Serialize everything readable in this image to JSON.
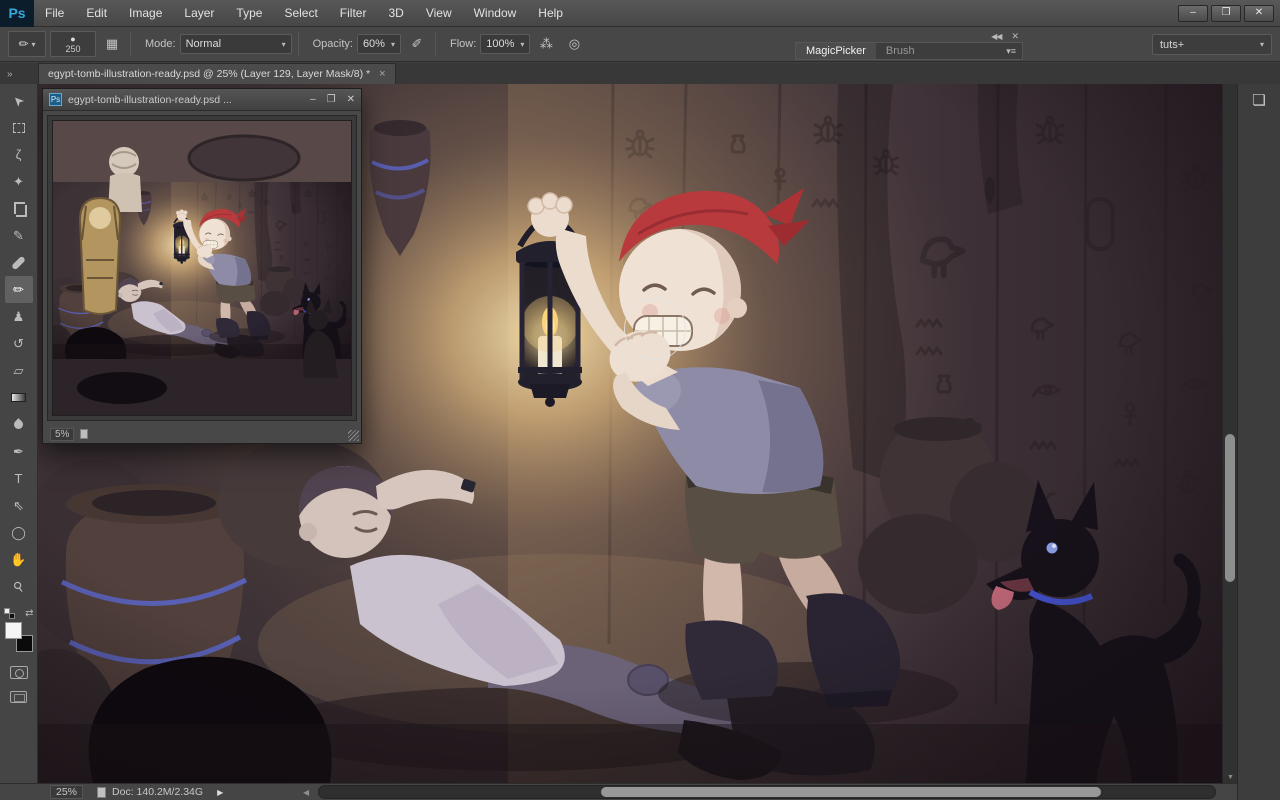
{
  "window_controls": {
    "minimize": "–",
    "restore": "❐",
    "close": "✕"
  },
  "menu_bar": {
    "logo": "Ps",
    "items": [
      "File",
      "Edit",
      "Image",
      "Layer",
      "Type",
      "Select",
      "Filter",
      "3D",
      "View",
      "Window",
      "Help"
    ]
  },
  "options_bar": {
    "tool_icon": "✏",
    "brush_tip_icon": "●",
    "brush_size": "250",
    "panel_toggle_icon": "▦",
    "mode_label": "Mode:",
    "mode_value": "Normal",
    "opacity_label": "Opacity:",
    "opacity_value": "60%",
    "pressure_opacity_icon": "✐",
    "flow_label": "Flow:",
    "flow_value": "100%",
    "airbrush_icon": "⁂",
    "pressure_size_icon": "◎",
    "caret": "▾",
    "panel_group": {
      "collapse_icon": "◀◀",
      "close_icon": "✕",
      "tabs": [
        {
          "label": "MagicPicker",
          "active": true
        },
        {
          "label": "Brush",
          "active": false
        }
      ],
      "menu_icon": "▾≡"
    },
    "workspace": {
      "label": "tuts+",
      "caret": "▾"
    }
  },
  "tab_bar": {
    "collapse_icon": "»",
    "doc_tab": {
      "title": "egypt-tomb-illustration-ready.psd @ 25% (Layer 129, Layer Mask/8) *",
      "close_icon": "×"
    }
  },
  "toolbar": {
    "tools": [
      {
        "name": "move",
        "glyph": "➤"
      },
      {
        "name": "rectangular-marquee",
        "glyph": ""
      },
      {
        "name": "lasso",
        "glyph": "ζ"
      },
      {
        "name": "quick-selection",
        "glyph": "✦"
      },
      {
        "name": "crop",
        "glyph": ""
      },
      {
        "name": "eyedropper",
        "glyph": "✎"
      },
      {
        "name": "spot-healing-brush",
        "glyph": ""
      },
      {
        "name": "brush",
        "glyph": "✏",
        "selected": true
      },
      {
        "name": "clone-stamp",
        "glyph": "♟"
      },
      {
        "name": "history-brush",
        "glyph": "↺"
      },
      {
        "name": "eraser",
        "glyph": "▱"
      },
      {
        "name": "gradient",
        "glyph": ""
      },
      {
        "name": "blur",
        "glyph": ""
      },
      {
        "name": "pen",
        "glyph": "✒"
      },
      {
        "name": "type",
        "glyph": "T"
      },
      {
        "name": "path-selection",
        "glyph": "⇖"
      },
      {
        "name": "ellipse",
        "glyph": "◯"
      },
      {
        "name": "hand",
        "glyph": "✋"
      },
      {
        "name": "zoom",
        "glyph": "⚲"
      }
    ],
    "swap_colors_icon": "⇄",
    "foreground_color": "#f5f5f5",
    "background_color": "#0b0b0b"
  },
  "floating_window": {
    "file_icon": "Ps",
    "title": "egypt-tomb-illustration-ready.psd ...",
    "minimize_icon": "–",
    "maximize_icon": "❐",
    "close_icon": "✕",
    "zoom": "5%"
  },
  "right_dock": {
    "collapse_icon": "◀◀",
    "panel_icon": "❏"
  },
  "status_bar": {
    "zoom": "25%",
    "doc_info": "Doc: 140.2M/2.34G",
    "flyout_icon": "▶",
    "scroll_left_icon": "◀",
    "scroll_down_icon": "▼"
  },
  "colors": {
    "ui_bar": "#474747",
    "ui_dark": "#3a3a3a",
    "ps_logo_blue": "#39a6dc",
    "bandana_red": "#b83a3c",
    "dog_collar_blue": "#4656d8",
    "lantern_glow": "#f0d9a0"
  }
}
